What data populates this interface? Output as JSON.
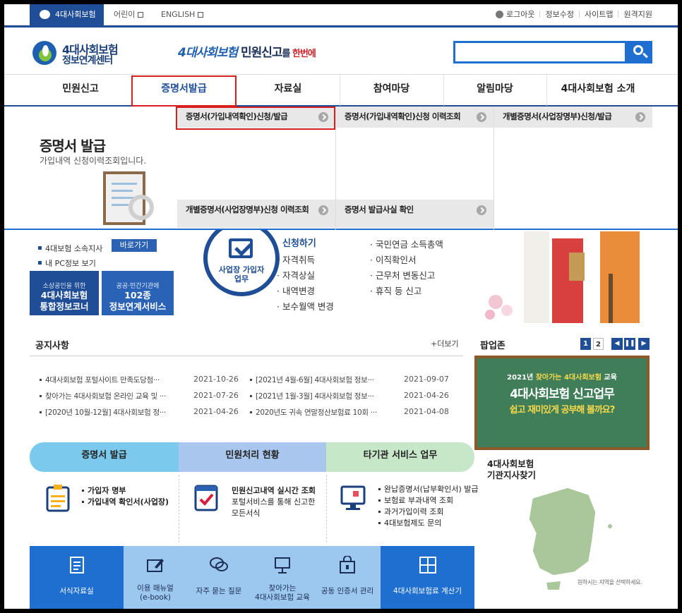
{
  "topbar": {
    "site_tab": "4대사회보험",
    "kids": "어린이",
    "english": "ENGLISH",
    "logout": "로그아웃",
    "edit_info": "정보수정",
    "sitemap": "사이트맵",
    "remote": "원격지원"
  },
  "header": {
    "logo_line1": "4대사회보험",
    "logo_line2": "정보연계센터",
    "slogan_a": "4대사회보험",
    "slogan_b": " 민원신고",
    "slogan_c": "를 ",
    "slogan_d": "한번에"
  },
  "nav": [
    "민원신고",
    "증명서발급",
    "자료실",
    "참여마당",
    "알림마당",
    "4대사회보험 소개"
  ],
  "dropdown": {
    "title": "증명서 발급",
    "subtitle": "가입내역 신청이력조회입니다.",
    "items": [
      "증명서(가입내역확인)신청/발급",
      "증명서(가입내역확인)신청 이력조회",
      "개별증명서(사업장명부)신청/발급",
      "개별증명서(사업장명부)신청 이력조회",
      "증명서 발급사실 확인"
    ]
  },
  "quick": {
    "branch": "4대보험 소속지사",
    "pc_info": "내 PC정보 보기",
    "go": "바로가기",
    "box1_small": "소상공인을 위한",
    "box1_l1": "4대사회보험",
    "box1_l2": "통합정보코너",
    "box2_small": "공공·민간기관에",
    "box2_l1": "102종",
    "box2_l2": "정보연계서비스"
  },
  "service": {
    "circle_l1": "사업장 가입자",
    "circle_l2": "업무",
    "link": "신청하기",
    "col1": [
      "자격취득",
      "자격상실",
      "내역변경",
      "보수월액 변경"
    ],
    "col2": [
      "국민연금 소득총액",
      "이직확인서",
      "근무처 변동신고",
      "휴직 등 신고"
    ]
  },
  "notice": {
    "title": "공지사항",
    "more": "+더보기",
    "rows": [
      {
        "t1": "4대사회보험 포털사이트 만족도당첨···",
        "d1": "2021-10-26",
        "t2": "[2021년 4월-6월] 4대사회보험 정보···",
        "d2": "2021-09-07"
      },
      {
        "t1": "찾아가는 4대사회보험 온라인 교육 및 ···",
        "d1": "2021-07-26",
        "t2": "[2021년 1월-3월] 4대사회보험 정보···",
        "d2": "2021-04-26"
      },
      {
        "t1": "[2020년 10월-12월] 4대사회보험 정···",
        "d1": "2021-04-26",
        "t2": "2020년도 귀속 연말정산보험료 10회 ···",
        "d2": "2021-04-08"
      }
    ]
  },
  "popup": {
    "title": "팝업존",
    "pages": [
      "1",
      "2"
    ],
    "banner_l1a": "2021년 ",
    "banner_l1b": "찾아가는 4대사회보험",
    "banner_l1c": " 교육",
    "banner_l2": "4대사회보험 신고업무",
    "banner_l3": "쉽고 재미있게 공부해 볼까요?"
  },
  "map": {
    "title_l1": "4대사회보험",
    "title_l2": "기관지사찾기",
    "hint": "원하시는 지역을 선택하세요."
  },
  "tabs": [
    {
      "title": "증명서 발급",
      "lines": [
        "가입자 명부",
        "가입내역 확인서(사업장)"
      ]
    },
    {
      "title": "민원처리 현황",
      "lines": [
        "민원신고내역 실시간 조회",
        "포털서비스를 통해 신고한",
        "모든서식"
      ]
    },
    {
      "title": "타기관 서비스 업무",
      "lines": [
        "완납증명서(납부확인서) 발급",
        "보험료 부과내역 조회",
        "과거가입이력 조회",
        "4대보험제도 문의"
      ]
    }
  ],
  "grid": [
    {
      "l1": "서식자료실",
      "l2": ""
    },
    {
      "l1": "이용 매뉴얼",
      "l2": "(e-book)"
    },
    {
      "l1": "자주 묻는 질문",
      "l2": ""
    },
    {
      "l1": "찾아가는",
      "l2": "4대사회보험 교육"
    },
    {
      "l1": "공동 인증서 관리",
      "l2": ""
    },
    {
      "l1": "4대사회보험료 계산기",
      "l2": ""
    }
  ]
}
